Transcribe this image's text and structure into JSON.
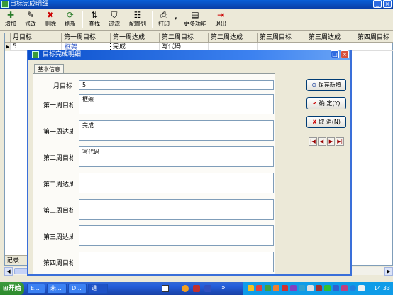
{
  "window": {
    "title": "目标完成明细"
  },
  "toolbar": [
    {
      "label": "增加",
      "glyph": "✚"
    },
    {
      "label": "修改",
      "glyph": "✎"
    },
    {
      "label": "删除",
      "glyph": "✖"
    },
    {
      "label": "刷新",
      "glyph": "⟳"
    },
    {
      "label": "查找",
      "glyph": "⇅"
    },
    {
      "label": "过滤",
      "glyph": "⛉"
    },
    {
      "label": "配置列",
      "glyph": "☷"
    },
    {
      "label": "打印",
      "glyph": "⎙"
    },
    {
      "label": "更多功能",
      "glyph": "▤"
    },
    {
      "label": "退出",
      "glyph": "⇥"
    }
  ],
  "grid": {
    "columns": [
      "月目标",
      "第一周目标",
      "第一周达成",
      "第二周目标",
      "第二周达成",
      "第三周目标",
      "第三周达成",
      "第四周目标"
    ],
    "rows": [
      {
        "indicator": "▶",
        "cells": [
          "5",
          "框架",
          "完成",
          "写代码",
          "",
          "",
          "",
          ""
        ]
      }
    ],
    "status": "记录"
  },
  "dialog": {
    "title": "目标完成明细",
    "tab": "基本信息",
    "fields": [
      {
        "label": "月目标：",
        "value": "5"
      },
      {
        "label": "第一周目标：",
        "value": "框架"
      },
      {
        "label": "第一周达成：",
        "value": "完成"
      },
      {
        "label": "第二周目标：",
        "value": "写代码"
      },
      {
        "label": "第二周达成：",
        "value": ""
      },
      {
        "label": "第三周目标：",
        "value": ""
      },
      {
        "label": "第三周达成：",
        "value": ""
      },
      {
        "label": "第四周目标：",
        "value": ""
      }
    ],
    "buttons": {
      "save_new": "保存新增",
      "ok": "确 定(Y)",
      "cancel": "取 消(N)"
    },
    "nav": [
      "|◀",
      "◀",
      "▶",
      "▶|"
    ]
  },
  "taskbar": {
    "start": "开始",
    "buttons": [
      "E...",
      "未...",
      "D...",
      "通"
    ],
    "clock": "14:33"
  },
  "colors": {
    "titlebar": "#0A4FCB",
    "taskbar": "#245EDC",
    "start": "#3C9A3C",
    "tray": "#0F9CE8",
    "accept": "#1A7F1A",
    "cancel": "#CC0000"
  }
}
